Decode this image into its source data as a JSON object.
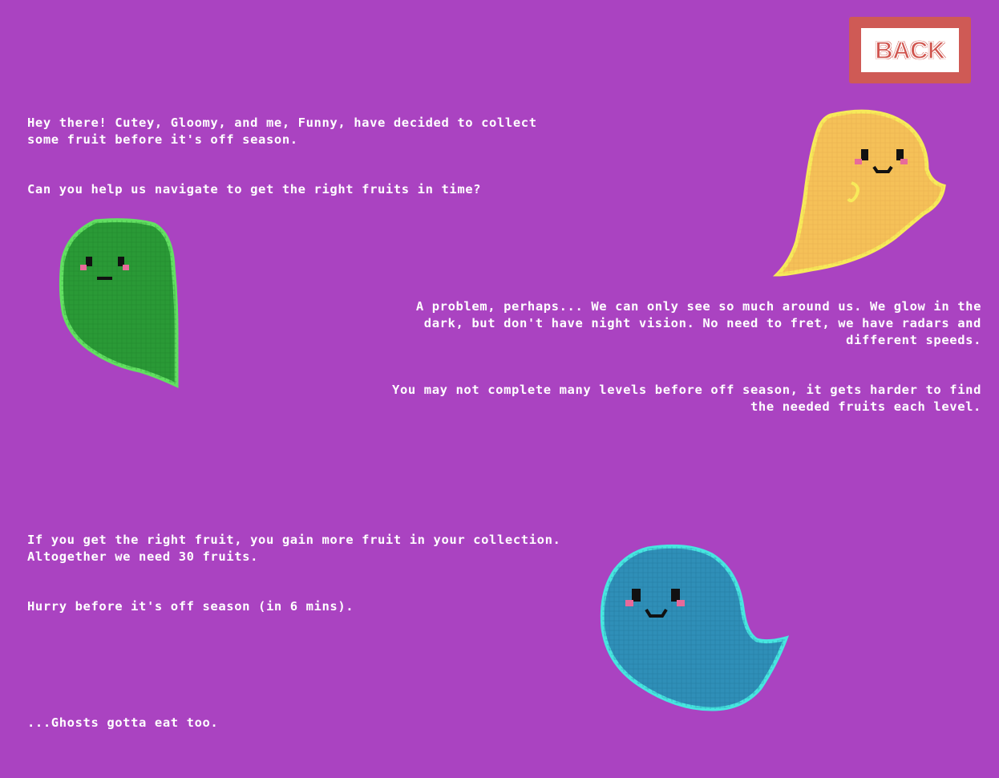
{
  "back_button": {
    "label": "BACK"
  },
  "intro": {
    "paragraphs": [
      "Hey there! Cutey, Gloomy, and me, Funny, have decided to collect\nsome fruit before it's off season.",
      "Can you help us navigate to get the right fruits in time?"
    ]
  },
  "problem": {
    "paragraphs": [
      "A problem, perhaps... We can only see so much around us. We glow in the\ndark, but don't have night vision. No need to fret, we have radars and\ndifferent speeds.",
      "You may not complete many levels before off season, it gets harder to find\nthe needed fruits each level."
    ]
  },
  "collect": {
    "paragraphs": [
      "If you get the right fruit, you gain more fruit in your collection.\nAltogether we need 30 fruits.",
      "Hurry before it's off season (in 6 mins)."
    ]
  },
  "outro": {
    "text": "...Ghosts gotta eat too."
  },
  "colors": {
    "background": "#aa43c1",
    "text": "#ffffff",
    "back_border": "#cf5a55",
    "ghost_yellow": "#f5c158",
    "ghost_yellow_edge": "#f7ea5a",
    "ghost_green": "#2a9a36",
    "ghost_green_edge": "#62e062",
    "ghost_blue": "#2f8fb8",
    "ghost_blue_edge": "#47e6e0",
    "blush": "#e86a9a"
  },
  "ghosts": [
    {
      "id": "yellow",
      "icon": "pixel-ghost-yellow-icon"
    },
    {
      "id": "green",
      "icon": "pixel-ghost-green-icon"
    },
    {
      "id": "blue",
      "icon": "pixel-ghost-blue-icon"
    }
  ]
}
